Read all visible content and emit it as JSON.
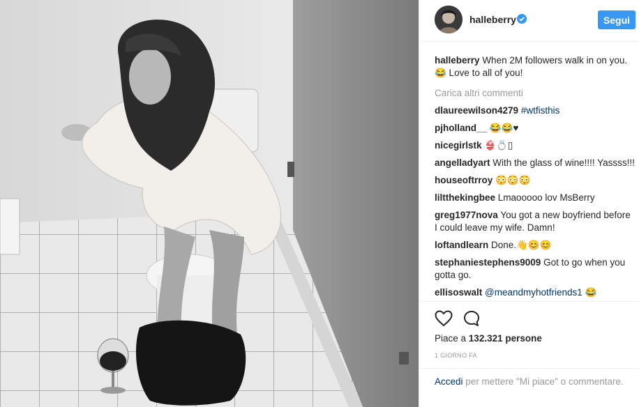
{
  "post": {
    "username": "halleberry",
    "follow_label": "Segui",
    "caption_user": "halleberry",
    "caption_text": "When 2M followers walk in on you. 😂 Love to all of you!",
    "load_more": "Carica altri commenti",
    "comments": [
      {
        "user": "dlaureewilson4279",
        "text": "",
        "tag": "#wtfisthis"
      },
      {
        "user": "pjholland__",
        "text": "😂😂♥",
        "tag": ""
      },
      {
        "user": "nicegirlstk",
        "text": "👙💍▯",
        "tag": ""
      },
      {
        "user": "angelladyart",
        "text": "With the glass of wine!!!! Yassss!!!",
        "tag": ""
      },
      {
        "user": "houseoftrroy",
        "text": "😳😳😳",
        "tag": ""
      },
      {
        "user": "liltthekingbee",
        "text": "Lmaooooo lov MsBerry",
        "tag": ""
      },
      {
        "user": "greg1977nova",
        "text": "You got a new boyfriend before I could leave my wife. Damn!",
        "tag": ""
      },
      {
        "user": "loftandlearn",
        "text": "Done.👋😊😊",
        "tag": ""
      },
      {
        "user": "stephaniestephens9009",
        "text": "Got to go when you gotta go.",
        "tag": ""
      },
      {
        "user": "ellisoswalt",
        "text": "😂",
        "tag": "@meandmyhotfriends1"
      }
    ],
    "likes_prefix": "Piace a",
    "likes_count": "132.321",
    "likes_suffix": "persone",
    "timestamp": "1 GIORNO FA",
    "login_link": "Accedi",
    "login_text": "per mettere \"Mi piace\" o commentare."
  },
  "icons": {
    "verified": "verified-badge-icon",
    "like": "heart-icon",
    "comment": "comment-bubble-icon"
  },
  "colors": {
    "accent": "#3897f0",
    "link": "#003569",
    "muted": "#999999",
    "text": "#262626"
  }
}
